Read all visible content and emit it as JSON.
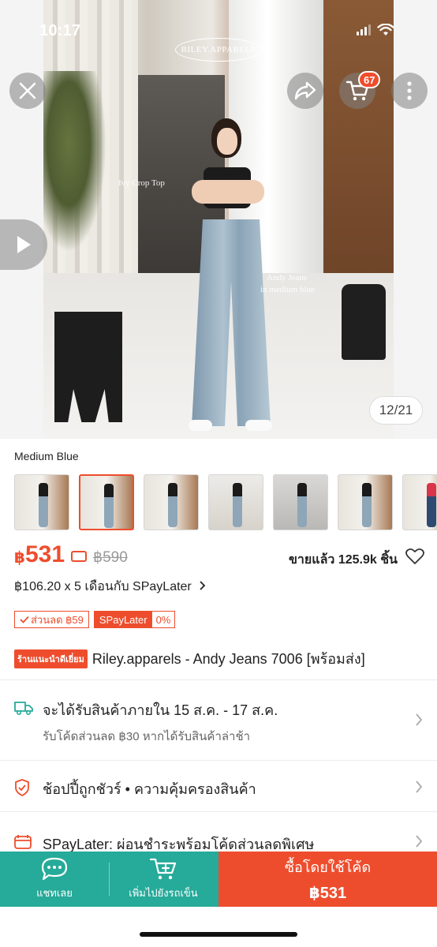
{
  "status_bar": {
    "time": "10:17"
  },
  "gallery": {
    "brand_logo_text": "RILEY.APPARELS",
    "caption_top": "Ivy Crop Top",
    "caption_jeans_line1": "Andy Jeans",
    "caption_jeans_line2": "in medium blue",
    "counter": "12/21",
    "cart_count": "67"
  },
  "icons": {
    "close": "close-icon",
    "share": "share-icon",
    "cart": "cart-icon",
    "more": "more-vertical-icon",
    "play": "play-icon",
    "heart": "heart-outline-icon",
    "truck": "truck-icon",
    "shield": "shield-check-icon",
    "spaylater": "spaylater-icon",
    "chat": "chat-icon",
    "add_cart": "add-to-cart-icon"
  },
  "variation": {
    "selected_label": "Medium Blue",
    "thumbnail_count": 7,
    "selected_index": 1
  },
  "price": {
    "currency": "฿",
    "current": "531",
    "original": "฿590",
    "sold_text": "ขายแล้ว 125.9k ชิ้น",
    "installment": "฿106.20 x 5 เดือนกับ SPayLater"
  },
  "tags": {
    "discount": "ส่วนลด ฿59",
    "spaylater_label": "SPayLater",
    "spaylater_rate": "0%"
  },
  "product": {
    "badge": "ร้านแนะนำดีเยี่ยม",
    "title": "Riley.apparels - Andy Jeans 7006 [พร้อมส่ง]"
  },
  "info_rows": {
    "delivery_main": "จะได้รับสินค้าภายใน 15 ส.ค. - 17 ส.ค.",
    "delivery_sub": "รับโค้ดส่วนลด ฿30 หากได้รับสินค้าล่าช้า",
    "guarantee": "ช้อปปี้ถูกชัวร์ • ความคุ้มครองสินค้า",
    "spaylater": "SPayLater: ผ่อนชำระพร้อมโค้ดส่วนลดพิเศษ"
  },
  "bottom_bar": {
    "chat_label": "แชทเลย",
    "add_cart_label": "เพิ่มไปยังรถเข็น",
    "buy_label": "ซื้อโดยใช้โค้ด",
    "buy_price": "฿531"
  },
  "colors": {
    "accent": "#ee4d2d",
    "teal": "#26aa99"
  }
}
